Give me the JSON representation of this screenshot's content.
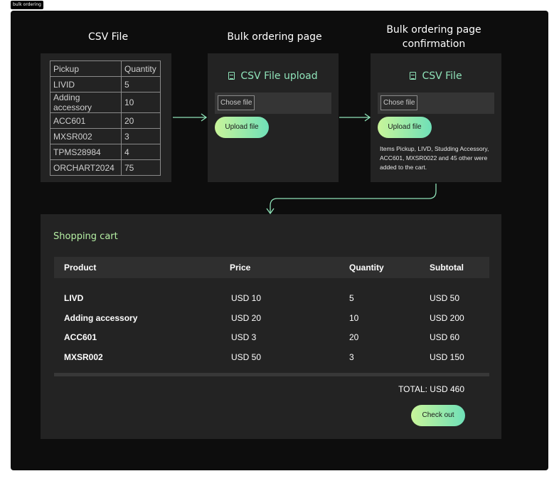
{
  "frame_label": "bulk ordering",
  "columns": {
    "csv_title": "CSV File",
    "bulk_title": "Bulk ordering page",
    "confirm_title_line1": "Bulk ordering page",
    "confirm_title_line2": "confirmation"
  },
  "csv_table": [
    [
      "Pickup",
      "Quantity"
    ],
    [
      "LIVID",
      "5"
    ],
    [
      "Adding accessory",
      "10"
    ],
    [
      "ACC601",
      "20"
    ],
    [
      "MXSR002",
      "3"
    ],
    [
      "TPMS28984",
      "4"
    ],
    [
      "ORCHART2024",
      "75"
    ]
  ],
  "upload_panel": {
    "heading": "CSV File upload",
    "chose_file_label": "Chose file",
    "upload_label": "Upload file",
    "icon": "document-icon"
  },
  "confirm_panel": {
    "heading": "CSV File",
    "chose_file_label": "Chose file",
    "upload_label": "Upload file",
    "message": "Items Pickup, LIVD, Studding Accessory, ACC601, MXSR0022 and 45 other were added to the cart.",
    "icon": "document-icon"
  },
  "cart": {
    "title": "Shopping cart",
    "headers": [
      "Product",
      "Price",
      "Quantity",
      "Subtotal"
    ],
    "rows": [
      [
        "LIVD",
        "USD 10",
        "5",
        "USD 50"
      ],
      [
        "Adding accessory",
        "USD 20",
        "10",
        "USD 200"
      ],
      [
        "ACC601",
        "USD 3",
        "20",
        "USD 60"
      ],
      [
        "MXSR002",
        "USD 50",
        "3",
        "USD 150"
      ]
    ],
    "total": "TOTAL: USD 460",
    "checkout_label": "Check out"
  },
  "colors": {
    "accent_green": "#8fe3b9",
    "gradient_start": "#c9f59a",
    "gradient_end": "#6fe0b8",
    "canvas": "#0d0d0d",
    "panel": "#232323"
  }
}
